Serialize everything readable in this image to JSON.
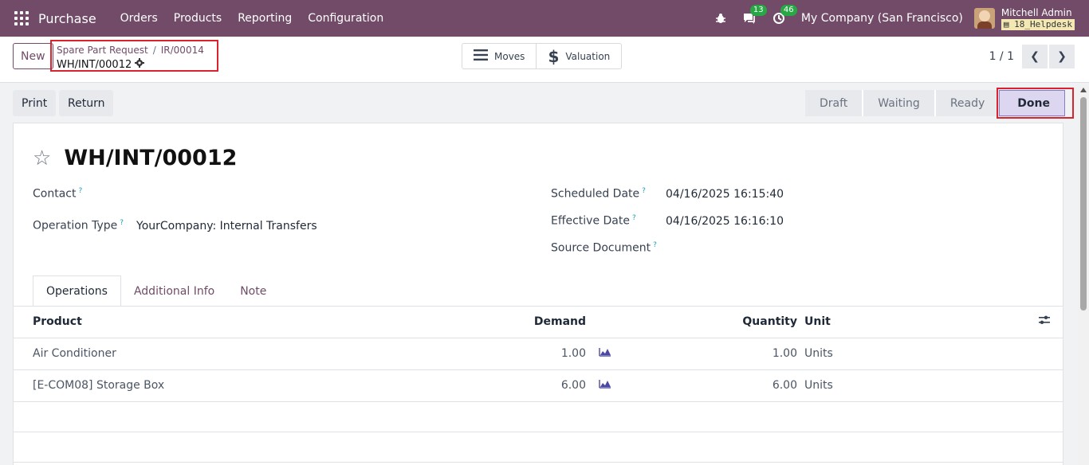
{
  "navbar": {
    "app_name": "Purchase",
    "menu": [
      "Orders",
      "Products",
      "Reporting",
      "Configuration"
    ],
    "bug_icon": "bug-icon",
    "messages_badge": "13",
    "activities_badge": "46",
    "company": "My Company (San Francisco)",
    "user_name": "Mitchell Admin",
    "database": "18_Helpdesk"
  },
  "control": {
    "new_label": "New",
    "breadcrumb": [
      "Spare Part Request",
      "IR/00014"
    ],
    "record_name": "WH/INT/00012",
    "smart_buttons": [
      {
        "label": "Moves",
        "icon": "list-icon"
      },
      {
        "label": "Valuation",
        "icon": "dollar-icon"
      }
    ],
    "pager": "1 / 1"
  },
  "actions": {
    "print_label": "Print",
    "return_label": "Return"
  },
  "statusbar": {
    "stages": [
      "Draft",
      "Waiting",
      "Ready",
      "Done"
    ],
    "current": "Done"
  },
  "form": {
    "title": "WH/INT/00012",
    "fields": {
      "contact_label": "Contact",
      "contact_value": "",
      "operation_type_label": "Operation Type",
      "operation_type_value": "YourCompany: Internal Transfers",
      "scheduled_date_label": "Scheduled Date",
      "scheduled_date_value": "04/16/2025 16:15:40",
      "effective_date_label": "Effective Date",
      "effective_date_value": "04/16/2025 16:16:10",
      "source_document_label": "Source Document",
      "source_document_value": ""
    },
    "help_mark": "?",
    "tabs": [
      "Operations",
      "Additional Info",
      "Note"
    ]
  },
  "operations": {
    "columns": {
      "product": "Product",
      "demand": "Demand",
      "quantity": "Quantity",
      "unit": "Unit"
    },
    "rows": [
      {
        "product": "Air Conditioner",
        "demand": "1.00",
        "quantity": "1.00",
        "unit": "Units"
      },
      {
        "product": "[E-COM08] Storage Box",
        "demand": "6.00",
        "quantity": "6.00",
        "unit": "Units"
      }
    ]
  },
  "colors": {
    "brand": "#714B67",
    "highlight": "#d9232e",
    "done_stage": "#ddd6f0"
  }
}
